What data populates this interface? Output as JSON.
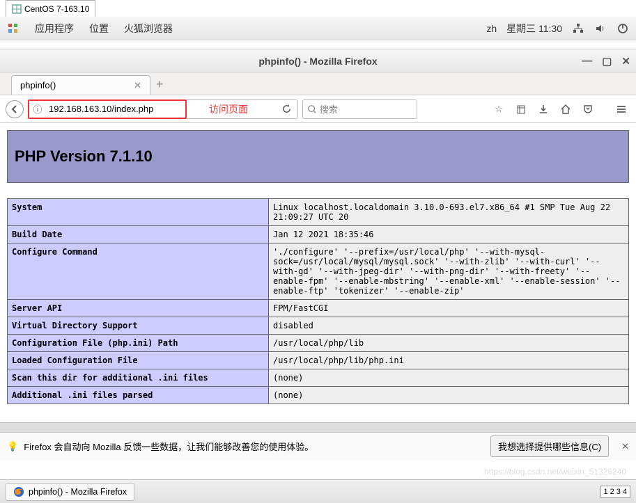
{
  "vm_tab": {
    "title": "CentOS 7-163.10"
  },
  "gnome": {
    "apps": "应用程序",
    "places": "位置",
    "browser": "火狐浏览器",
    "lang": "zh",
    "clock": "星期三 11:30"
  },
  "firefox": {
    "window_title": "phpinfo() - Mozilla Firefox",
    "tab_title": "phpinfo()",
    "url": "192.168.163.10/index.php",
    "annotation": "访问页面",
    "search_placeholder": "搜索",
    "infobar_text": "Firefox 会自动向 Mozilla 反馈一些数据，让我们能够改善您的使用体验。",
    "infobar_button": "我想选择提供哪些信息(C)"
  },
  "phpinfo": {
    "version_title": "PHP Version 7.1.10",
    "rows": [
      {
        "name": "System",
        "value": "Linux localhost.localdomain 3.10.0-693.el7.x86_64 #1 SMP Tue Aug 22 21:09:27 UTC 20"
      },
      {
        "name": "Build Date",
        "value": "Jan 12 2021 18:35:46"
      },
      {
        "name": "Configure Command",
        "value": "'./configure' '--prefix=/usr/local/php' '--with-mysql-sock=/usr/local/mysql/mysql.sock' '--with-zlib' '--with-curl' '--with-gd' '--with-jpeg-dir' '--with-png-dir' '--with-freety' '--enable-fpm' '--enable-mbstring' '--enable-xml' '--enable-session' '--enable-ftp' 'tokenizer' '--enable-zip'"
      },
      {
        "name": "Server API",
        "value": "FPM/FastCGI"
      },
      {
        "name": "Virtual Directory Support",
        "value": "disabled"
      },
      {
        "name": "Configuration File (php.ini) Path",
        "value": "/usr/local/php/lib"
      },
      {
        "name": "Loaded Configuration File",
        "value": "/usr/local/php/lib/php.ini"
      },
      {
        "name": "Scan this dir for additional .ini files",
        "value": "(none)"
      },
      {
        "name": "Additional .ini files parsed",
        "value": "(none)"
      }
    ]
  },
  "taskbar": {
    "task_title": "phpinfo() - Mozilla Firefox",
    "pager": [
      "1",
      "2",
      "3",
      "4"
    ]
  },
  "watermark": "https://blog.csdn.net/weixin_51326240"
}
